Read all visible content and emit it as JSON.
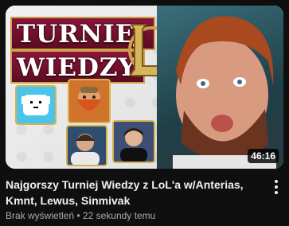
{
  "thumbnail": {
    "title_line_1": "TURNIEJ",
    "title_line_2": "WIEDZY",
    "emblem_letter": "L",
    "duration": "46:16",
    "colors": {
      "banner": "#8a1538",
      "banner_border": "#c9a24a",
      "dog_tile": "#4ac4ea",
      "dwarf_tile": "#d0732d"
    }
  },
  "video": {
    "title": "Najgorszy Turniej Wiedzy z LoL'a w/Anterias, Kmnt, Lewus, Sinmivak",
    "views": "Brak wyświetleń",
    "separator": "•",
    "uploaded": "22 sekundy temu"
  },
  "icons": {
    "more": "more-vert-icon"
  }
}
